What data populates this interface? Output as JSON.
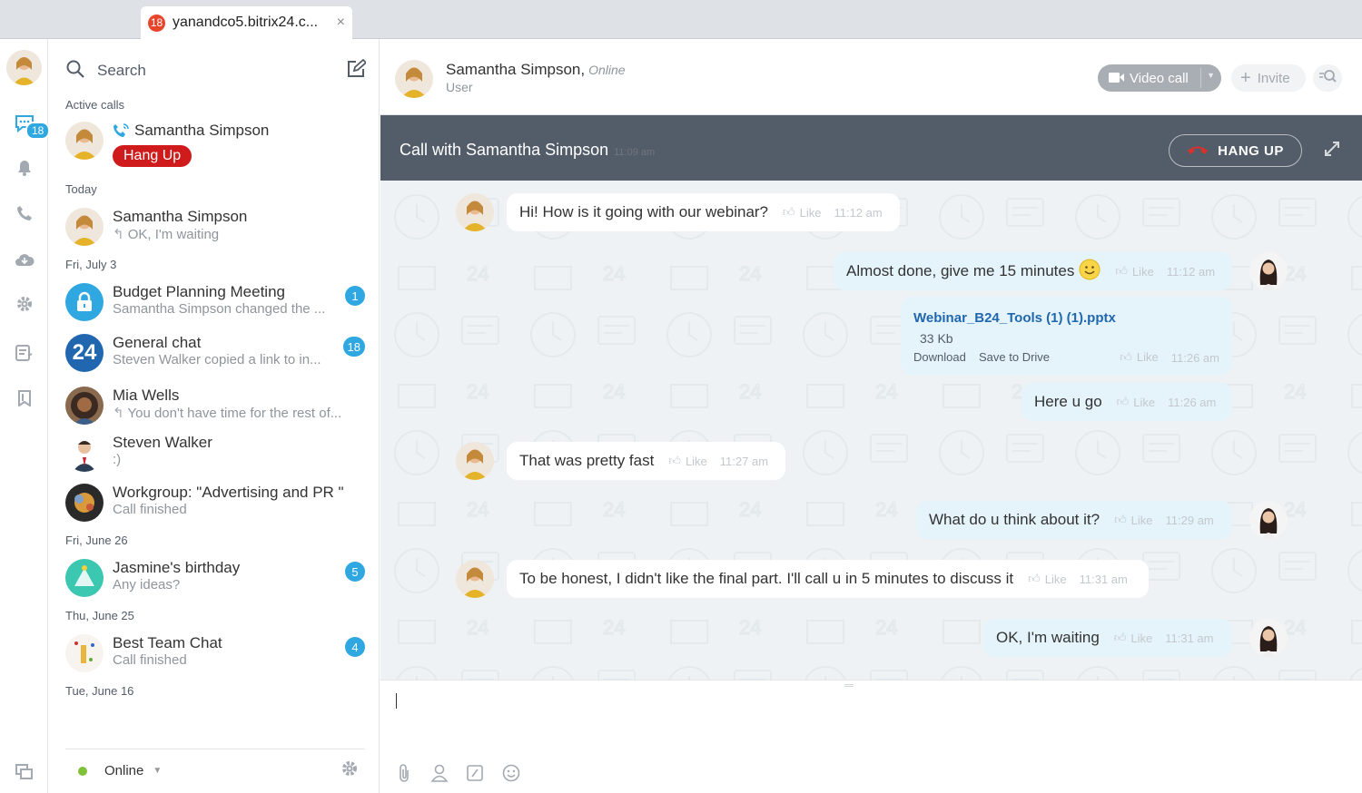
{
  "browser": {
    "tab_badge": "18",
    "tab_title": "yanandco5.bitrix24.c...",
    "tab_close": "×"
  },
  "rail": {
    "chat_badge": "18"
  },
  "list": {
    "search_label": "Search",
    "sections": {
      "active_calls": "Active calls",
      "today": "Today",
      "fri_july3": "Fri, July 3",
      "fri_june26": "Fri, June 26",
      "thu_june25": "Thu, June 25",
      "tue_june16": "Tue, June 16"
    },
    "active_call": {
      "name": "Samantha Simpson",
      "hang_up": "Hang Up"
    },
    "items": [
      {
        "name": "Samantha Simpson",
        "sub": "OK, I'm waiting",
        "counter": ""
      },
      {
        "name": "Budget Planning Meeting",
        "sub": "Samantha Simpson changed the ...",
        "counter": "1"
      },
      {
        "name": "General chat",
        "sub": "Steven Walker copied a link to in...",
        "counter": "18",
        "avatar_text": "24"
      },
      {
        "name": "Mia Wells",
        "sub": "You don't have time for the rest of...",
        "counter": ""
      },
      {
        "name": "Steven Walker",
        "sub": ":)",
        "counter": ""
      },
      {
        "name": "Workgroup: \"Advertising and PR \"",
        "sub": "Call finished",
        "counter": ""
      },
      {
        "name": "Jasmine's birthday",
        "sub": "Any ideas?",
        "counter": "5"
      },
      {
        "name": "Best Team Chat",
        "sub": "Call finished",
        "counter": "4"
      }
    ],
    "status": "Online"
  },
  "chat": {
    "header": {
      "name": "Samantha Simpson",
      "online": "Online",
      "role": "User"
    },
    "buttons": {
      "video_call": "Video call",
      "invite": "Invite"
    },
    "callbar": {
      "prefix": "Call with ",
      "name": "Samantha Simpson",
      "time": "11:09 am",
      "hang_up": "HANG UP"
    },
    "messages": [
      {
        "text": "Hi! How is it going with our webinar?",
        "like": "Like",
        "time": "11:12 am"
      },
      {
        "text": "Almost done, give me 15 minutes",
        "like": "Like",
        "time": "11:12 am"
      },
      {
        "text": "Here u go",
        "like": "Like",
        "time": "11:26 am"
      },
      {
        "text": "That was pretty fast",
        "like": "Like",
        "time": "11:27 am"
      },
      {
        "text": "What do u think about it?",
        "like": "Like",
        "time": "11:29 am"
      },
      {
        "text": "To be honest, I didn't like the final part. I'll call u in 5 minutes to discuss it",
        "like": "Like",
        "time": "11:31 am"
      },
      {
        "text": "OK, I'm waiting",
        "like": "Like",
        "time": "11:31 am"
      }
    ],
    "file": {
      "name": "Webinar_B24_Tools (1) (1).pptx",
      "size": "33 Kb",
      "download": "Download",
      "save": "Save to Drive",
      "like": "Like",
      "time": "11:26 am"
    }
  },
  "colors": {
    "accent": "#2fa7e0",
    "hangup_red": "#cf1b1b",
    "callbar": "#535c69",
    "chat_bg": "#eef2f4",
    "out_bubble": "#e5f4fb"
  }
}
